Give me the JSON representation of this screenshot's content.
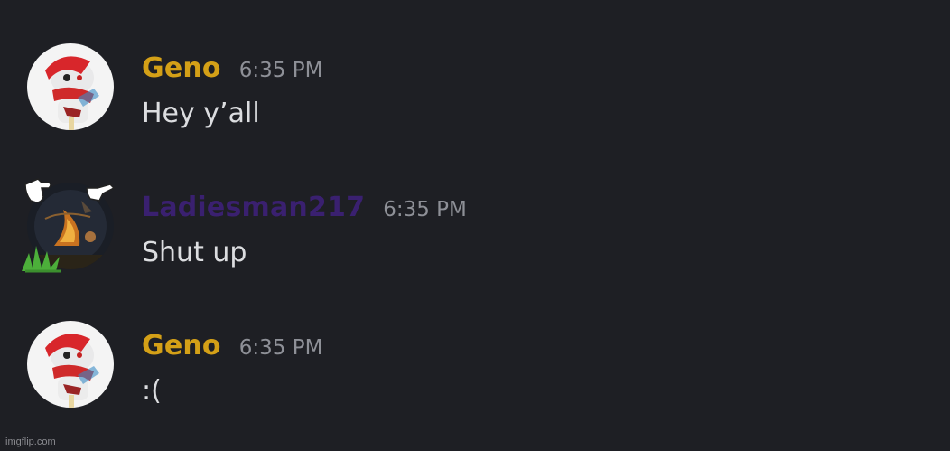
{
  "messages": [
    {
      "username": "Geno",
      "username_color": "#d4a017",
      "timestamp": "6:35 PM",
      "text": "Hey y’all",
      "avatar_icon": "geno-avatar"
    },
    {
      "username": "Ladiesman217",
      "username_color": "#3a2070",
      "timestamp": "6:35 PM",
      "text": "Shut up",
      "avatar_icon": "fiery-scene-avatar"
    },
    {
      "username": "Geno",
      "username_color": "#d4a017",
      "timestamp": "6:35 PM",
      "text": ":(",
      "avatar_icon": "geno-avatar"
    }
  ],
  "watermark": "imgflip.com"
}
